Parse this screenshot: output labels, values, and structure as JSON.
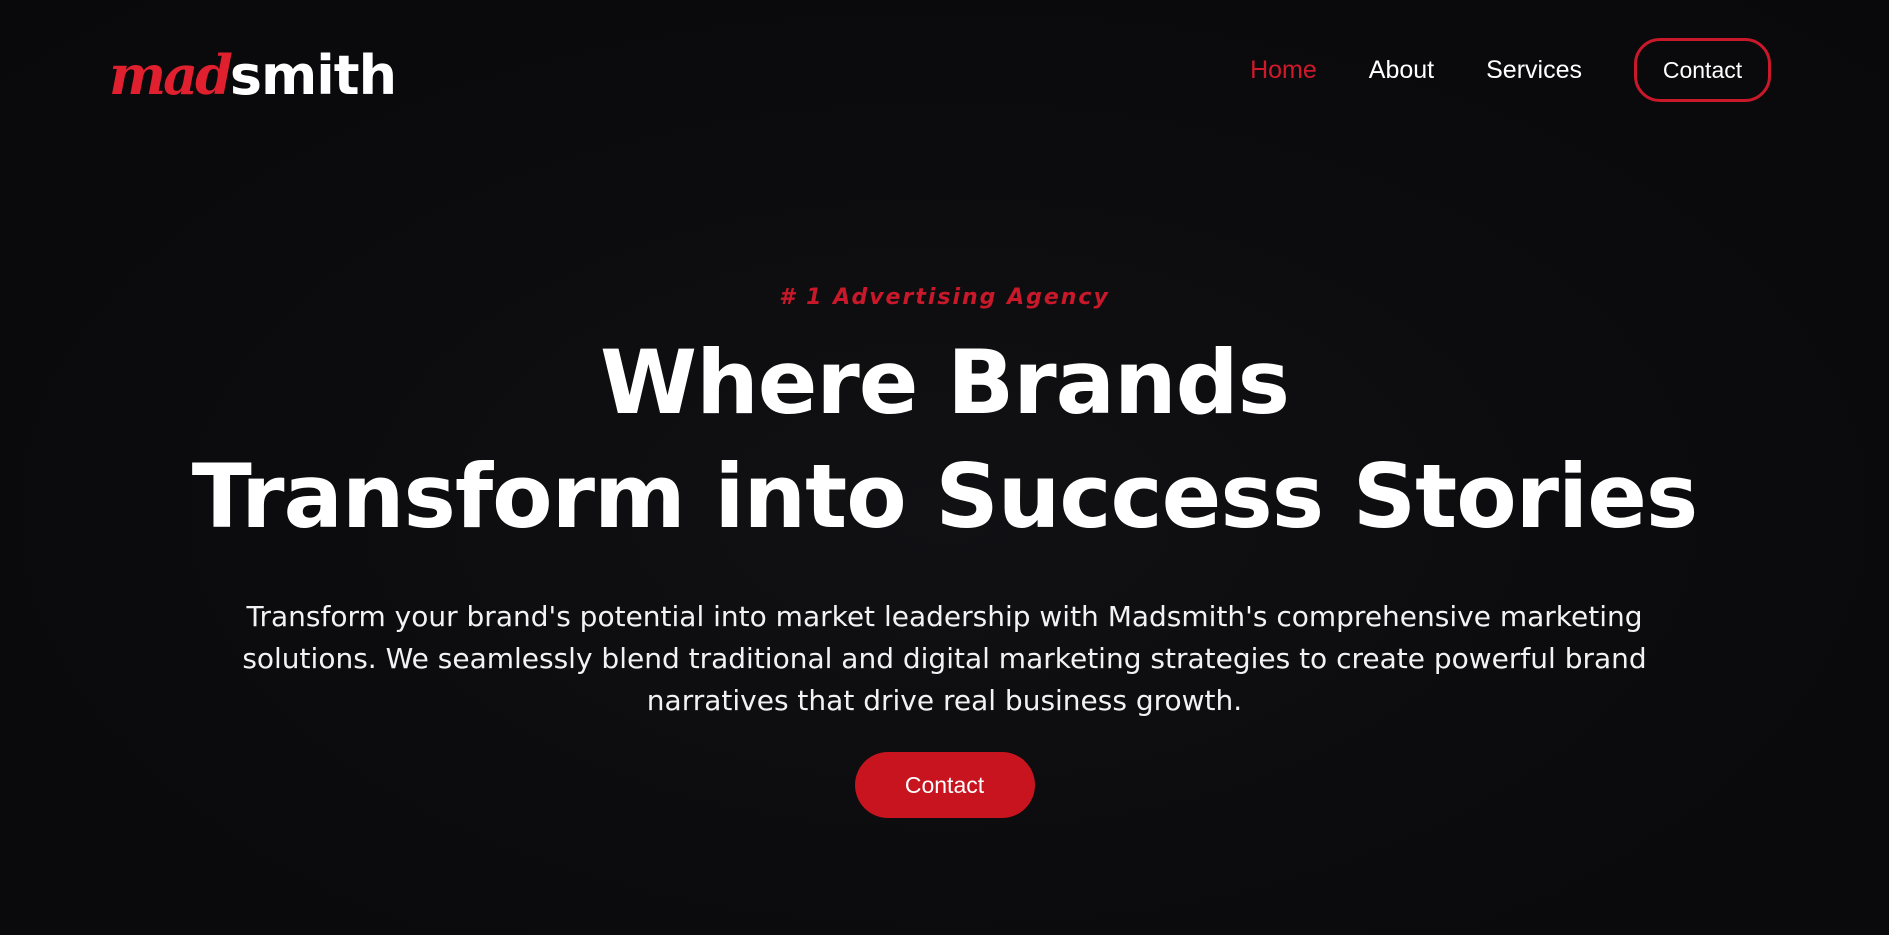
{
  "header": {
    "logo": {
      "part_a": "mad",
      "part_b": "smith",
      "accent_color": "#e0202f"
    },
    "nav": {
      "items": [
        {
          "label": "Home",
          "active": true
        },
        {
          "label": "About",
          "active": false
        },
        {
          "label": "Services",
          "active": false
        }
      ],
      "contact_label": "Contact"
    }
  },
  "hero": {
    "eyebrow": "# 1 Advertising Agency",
    "headline_line1": "Where Brands",
    "headline_line2": "Transform into Success Stories",
    "subtext": "Transform your brand's potential into market leadership with Madsmith's comprehensive marketing solutions. We seamlessly blend traditional and digital marketing strategies to create powerful brand narratives that drive real business growth.",
    "cta_label": "Contact"
  },
  "colors": {
    "background": "#0b0b0d",
    "accent": "#c8182a",
    "text": "#ffffff"
  }
}
